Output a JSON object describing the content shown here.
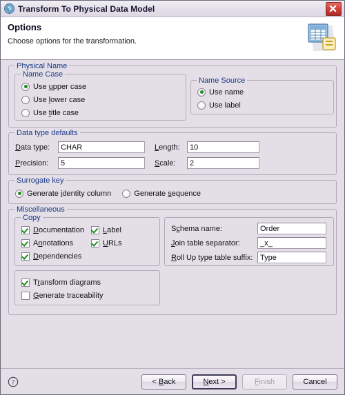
{
  "window": {
    "title": "Transform To Physical Data Model",
    "title_icon": "gem-icon",
    "close_icon": "close-icon"
  },
  "banner": {
    "title": "Options",
    "subtitle": "Choose options for the transformation.",
    "icon": "data-model-wizard-icon"
  },
  "physical_name": {
    "legend": "Physical Name",
    "name_case": {
      "legend": "Name Case",
      "options": [
        {
          "label": "Use upper case",
          "mnemonic": "u",
          "selected": true
        },
        {
          "label": "Use lower case",
          "mnemonic": "l",
          "selected": false
        },
        {
          "label": "Use title case",
          "mnemonic": "t",
          "selected": false
        }
      ]
    },
    "name_source": {
      "legend": "Name Source",
      "options": [
        {
          "label": "Use name",
          "selected": true
        },
        {
          "label": "Use label",
          "selected": false
        }
      ]
    }
  },
  "data_type_defaults": {
    "legend": "Data type defaults",
    "fields": [
      {
        "label": "Data type:",
        "mnemonic": "D",
        "value": "CHAR"
      },
      {
        "label": "Length:",
        "mnemonic": "L",
        "value": "10"
      },
      {
        "label": "Precision:",
        "mnemonic": "P",
        "value": "5"
      },
      {
        "label": "Scale:",
        "mnemonic": "S",
        "value": "2"
      }
    ]
  },
  "surrogate_key": {
    "legend": "Surrogate key",
    "options": [
      {
        "label": "Generate identity column",
        "mnemonic": "i",
        "selected": true
      },
      {
        "label": "Generate sequence",
        "mnemonic": "s",
        "selected": false
      }
    ]
  },
  "miscellaneous": {
    "legend": "Miscellaneous",
    "copy": {
      "legend": "Copy",
      "column_left": [
        {
          "label": "Documentation",
          "mnemonic": "D",
          "checked": true
        },
        {
          "label": "Annotations",
          "mnemonic": "n",
          "checked": true
        },
        {
          "label": "Dependencies",
          "mnemonic": "D",
          "checked": true
        }
      ],
      "column_right": [
        {
          "label": "Label",
          "mnemonic": "L",
          "checked": true
        },
        {
          "label": "URLs",
          "mnemonic": "U",
          "checked": true
        }
      ]
    },
    "transform": [
      {
        "label": "Transform diagrams",
        "mnemonic": "r",
        "checked": true
      },
      {
        "label": "Generate traceability",
        "mnemonic": "G",
        "checked": false
      }
    ],
    "naming_fields": [
      {
        "label": "Schema name:",
        "mnemonic": "c",
        "value": "Order"
      },
      {
        "label": "Join table separator:",
        "mnemonic": "J",
        "value": "_x_"
      },
      {
        "label": "Roll Up type table suffix:",
        "mnemonic": "R",
        "value": "Type"
      }
    ]
  },
  "buttons": {
    "help_icon": "help-icon",
    "back": {
      "label": "< Back",
      "mnemonic": "B",
      "disabled": false
    },
    "next": {
      "label": "Next >",
      "mnemonic": "N",
      "disabled": false,
      "default": true
    },
    "finish": {
      "label": "Finish",
      "mnemonic": "F",
      "disabled": true
    },
    "cancel": {
      "label": "Cancel",
      "disabled": false
    }
  },
  "colors": {
    "dialog_bg": "#e4dfe7",
    "banner_bg": "#ffffff",
    "group_legend": "#1b3a87",
    "check_green": "#1e8b1e",
    "close_red": "#cf3f38"
  }
}
